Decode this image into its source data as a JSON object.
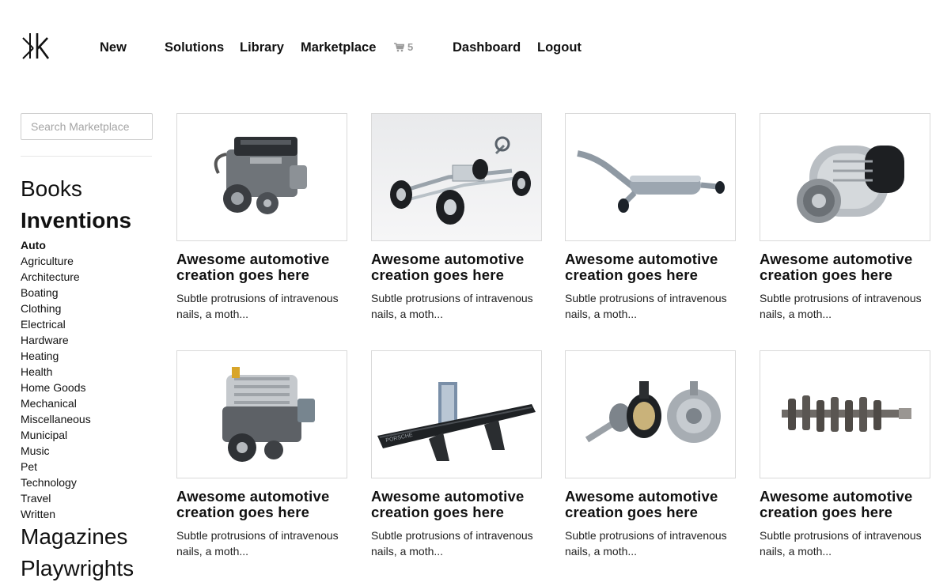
{
  "header": {
    "nav": [
      "New",
      "Solutions",
      "Library",
      "Marketplace"
    ],
    "cart_count": "5",
    "account": [
      "Dashboard",
      "Logout"
    ]
  },
  "sidebar": {
    "search_placeholder": "Search Marketplace",
    "categories": {
      "books": "Books",
      "inventions": "Inventions",
      "magazines": "Magazines",
      "playwrights": "Playwrights"
    },
    "subcategories": [
      "Auto",
      "Agriculture",
      "Architecture",
      "Boating",
      "Clothing",
      "Electrical",
      "Hardware",
      "Heating",
      "Health",
      "Home Goods",
      "Mechanical",
      "Miscellaneous",
      "Municipal",
      "Music",
      "Pet",
      "Technology",
      "Travel",
      "Written"
    ],
    "active_subcategory": "Auto"
  },
  "products": [
    {
      "image": "engine-image",
      "title": "Awesome automotive creation goes here",
      "desc": "Subtle protrusions of intravenous nails, a moth..."
    },
    {
      "image": "chassis-image",
      "title": "Awesome automotive creation goes here",
      "desc": "Subtle protrusions of intravenous nails, a moth..."
    },
    {
      "image": "exhaust-image",
      "title": "Awesome automotive creation goes here",
      "desc": "Subtle protrusions of intravenous nails, a moth..."
    },
    {
      "image": "alternator-image",
      "title": "Awesome automotive creation goes here",
      "desc": "Subtle protrusions of intravenous nails, a moth..."
    },
    {
      "image": "v8-engine-image",
      "title": "Awesome automotive creation goes here",
      "desc": "Subtle protrusions of intravenous nails, a moth..."
    },
    {
      "image": "spoiler-image",
      "title": "Awesome automotive creation goes here",
      "desc": "Subtle protrusions of intravenous nails, a moth..."
    },
    {
      "image": "axle-hub-image",
      "title": "Awesome automotive creation goes here",
      "desc": "Subtle protrusions of intravenous nails, a moth..."
    },
    {
      "image": "crankshaft-image",
      "title": "Awesome automotive creation goes here",
      "desc": "Subtle protrusions of intravenous nails, a moth..."
    }
  ]
}
